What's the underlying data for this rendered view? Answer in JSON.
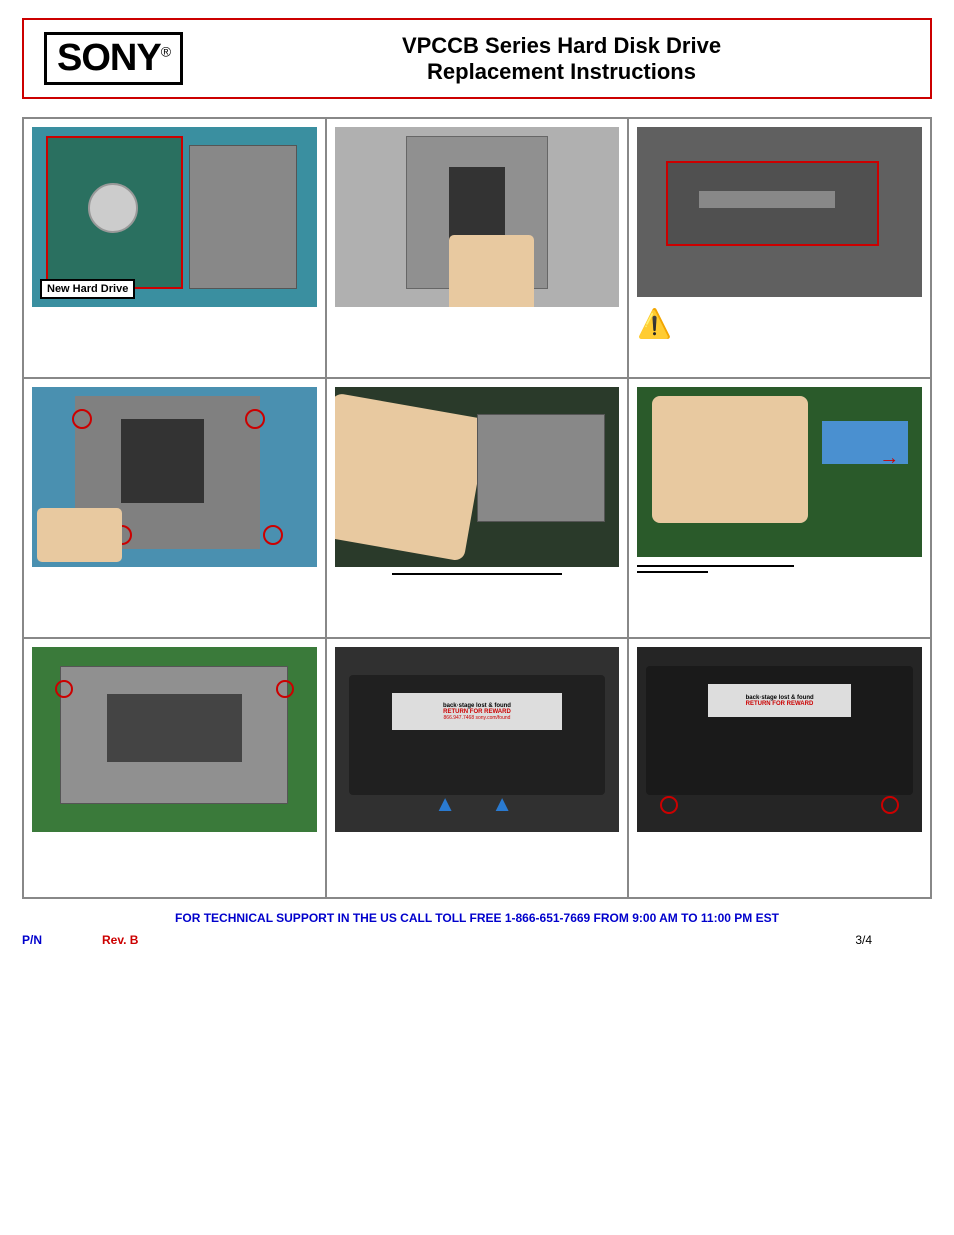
{
  "header": {
    "brand": "SONY",
    "brand_reg": "®",
    "title_line1": "VPCCB Series Hard Disk Drive",
    "title_line2": "Replacement Instructions"
  },
  "cells": {
    "r1c1": {
      "label": "New Hard Drive"
    },
    "r2c2_underline": "",
    "r2c3_underline1": "",
    "r2c3_underline2": ""
  },
  "footer": {
    "support_text": "FOR TECHNICAL SUPPORT IN THE US CALL TOLL FREE 1-866-651-7669 FROM 9:00 AM TO 11:00 PM EST",
    "pn_label": "P/N",
    "rev_label": "Rev. B",
    "page": "3/4"
  }
}
